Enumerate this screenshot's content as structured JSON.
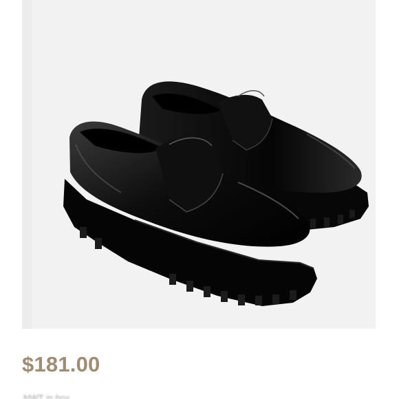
{
  "product": {
    "image_alt": "black patent loafers with lug soles",
    "price": "$181.00",
    "subtext": "NWT in box"
  },
  "colors": {
    "price": "#a08b73",
    "photo_background": "#f2f2f2",
    "shoe": "#0d0d0d"
  }
}
